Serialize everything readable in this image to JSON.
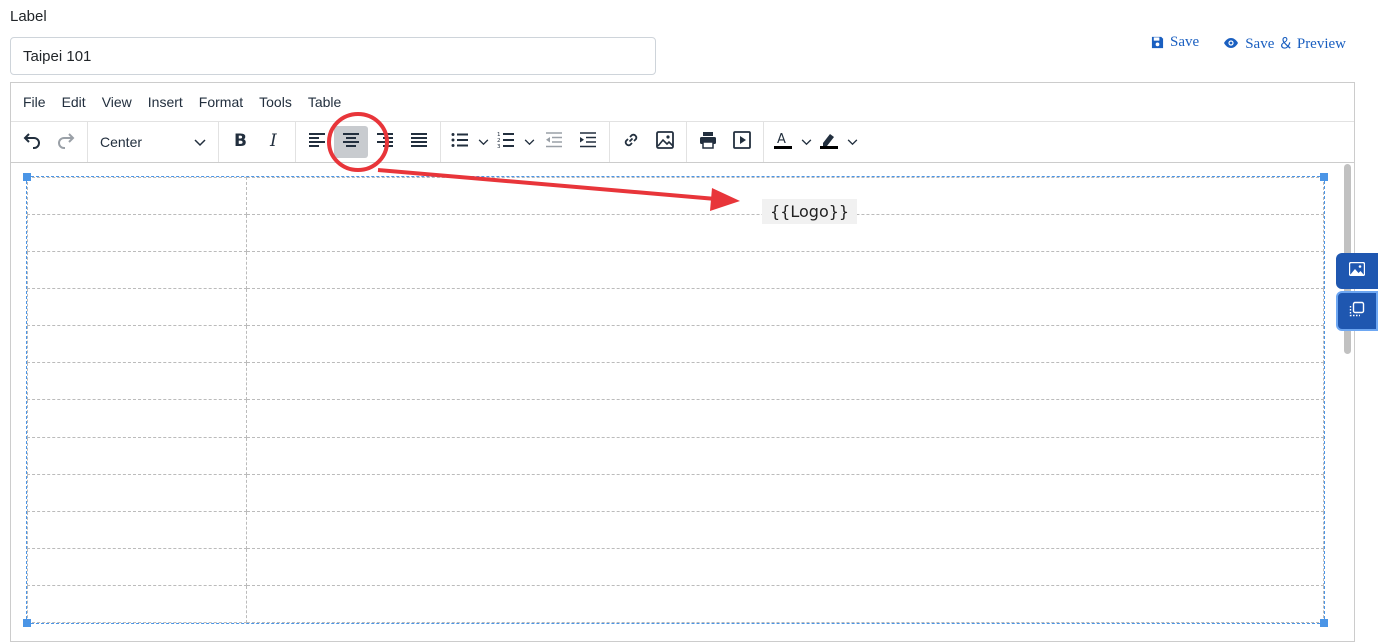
{
  "form": {
    "label": "Label",
    "input_value": "Taipei 101"
  },
  "actions": {
    "save": "Save",
    "save_preview": "Save ＆ Preview"
  },
  "menu": [
    "File",
    "Edit",
    "View",
    "Insert",
    "Format",
    "Tools",
    "Table"
  ],
  "toolbar": {
    "block_format": "Center"
  },
  "content": {
    "placeholder_tag": "{{Logo}}"
  },
  "table": {
    "rows": 12,
    "cols": 2
  },
  "colors": {
    "accent": "#1a5fc0",
    "annotation": "#e8353a",
    "selection": "#4b95e6"
  }
}
